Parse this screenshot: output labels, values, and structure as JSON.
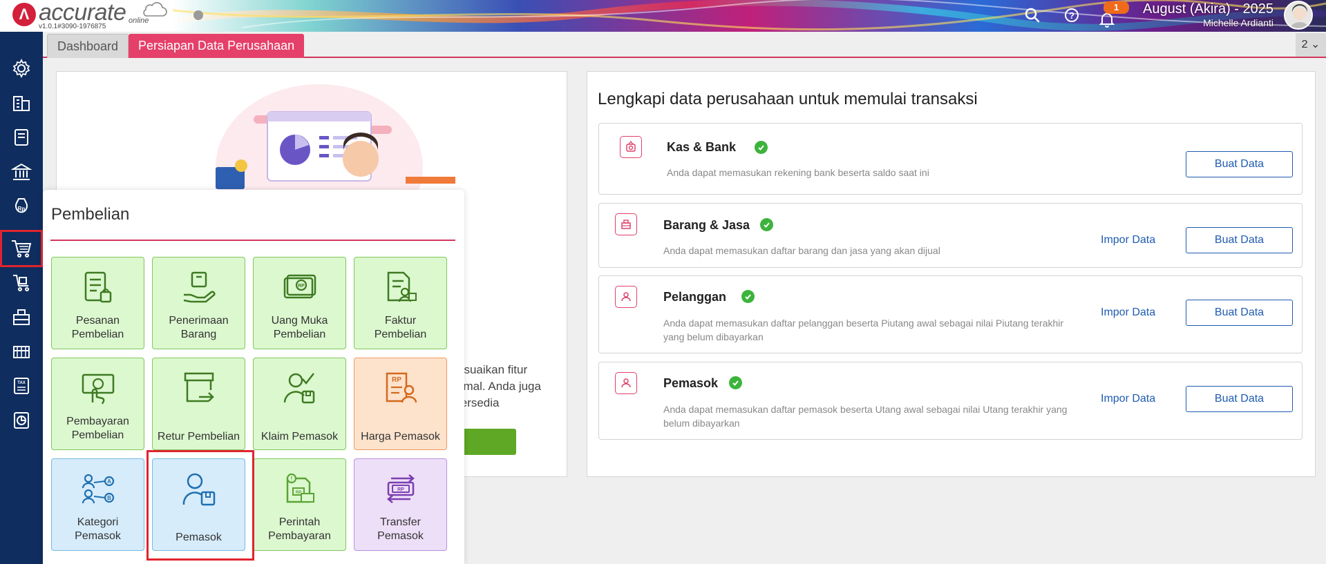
{
  "app": {
    "brand": "accurate",
    "brand_suffix": "online",
    "version": "v1.0.1#3090-1976875",
    "notification_count": "1",
    "period": "August (Akira) - 2025",
    "user": "Michelle Ardianti"
  },
  "tabs": {
    "dashboard": "Dashboard",
    "active": "Persiapan Data Perusahaan",
    "count": "2"
  },
  "sidebar_icons": [
    "settings-icon",
    "company-icon",
    "ledger-icon",
    "bank-icon",
    "receivable-icon",
    "cart-icon",
    "delivery-icon",
    "inventory-icon",
    "warehouse-icon",
    "tax-icon",
    "report-icon"
  ],
  "left_card": {
    "partial_text_lines": [
      "esuaikan fitur",
      "timal. Anda juga",
      "tersedia"
    ]
  },
  "right_card": {
    "title": "Lengkapi data perusahaan untuk memulai transaksi",
    "rows": [
      {
        "title": "Kas & Bank",
        "desc": "Anda dapat memasukan rekening bank beserta saldo saat ini",
        "import": "",
        "button": "Buat Data"
      },
      {
        "title": "Barang & Jasa",
        "desc": "Anda dapat memasukan daftar barang dan jasa yang akan dijual",
        "import": "Impor Data",
        "button": "Buat Data"
      },
      {
        "title": "Pelanggan",
        "desc": "Anda dapat memasukan daftar pelanggan beserta Piutang awal sebagai nilai Piutang terakhir yang belum dibayarkan",
        "import": "Impor Data",
        "button": "Buat Data"
      },
      {
        "title": "Pemasok",
        "desc": "Anda dapat memasukan daftar pemasok beserta Utang awal sebagai nilai Utang terakhir yang belum dibayarkan",
        "import": "Impor Data",
        "button": "Buat Data"
      }
    ]
  },
  "popup": {
    "title": "Pembelian",
    "tiles": [
      {
        "line1": "Pesanan",
        "line2": "Pembelian"
      },
      {
        "line1": "Penerimaan",
        "line2": "Barang"
      },
      {
        "line1": "Uang Muka",
        "line2": "Pembelian"
      },
      {
        "line1": "Faktur",
        "line2": "Pembelian"
      },
      {
        "line1": "Pembayaran",
        "line2": "Pembelian"
      },
      {
        "line1": "Retur Pembelian",
        "line2": ""
      },
      {
        "line1": "Klaim Pemasok",
        "line2": ""
      },
      {
        "line1": "Harga Pemasok",
        "line2": ""
      },
      {
        "line1": "Kategori",
        "line2": "Pemasok"
      },
      {
        "line1": "Pemasok",
        "line2": ""
      },
      {
        "line1": "Perintah",
        "line2": "Pembayaran"
      },
      {
        "line1": "Transfer",
        "line2": "Pemasok"
      }
    ]
  },
  "colors": {
    "sidebar": "#0f2d5e",
    "accent": "#e5406a",
    "link": "#1e5bb0",
    "check": "#3cb43c",
    "highlight": "#e0242f"
  }
}
